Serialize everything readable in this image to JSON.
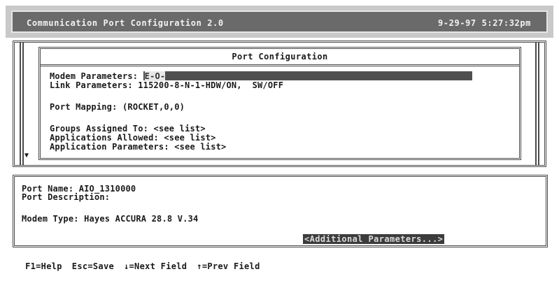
{
  "titlebar": {
    "title": "Communication Port Configuration  2.0",
    "datetime": "9-29-97 5:27:32pm"
  },
  "port_config": {
    "header": "Port Configuration",
    "modem_parameters_label": "Modem Parameters:",
    "modem_parameters_value": "E-O-",
    "link_parameters_label": "Link Parameters:",
    "link_parameters_value": "115200-8-N-1-HDW/ON,  SW/OFF",
    "port_mapping_label": "Port Mapping:",
    "port_mapping_value": "(ROCKET,0,0)",
    "groups_label": "Groups Assigned To:",
    "groups_value": "<see list>",
    "apps_allowed_label": "Applications Allowed:",
    "apps_allowed_value": "<see list>",
    "app_params_label": "Application Parameters:",
    "app_params_value": "<see list>",
    "scroll_indicator": "▼"
  },
  "port_info": {
    "port_name_label": "Port Name:",
    "port_name_value": "AIO_1310000",
    "port_description_label": "Port Description:",
    "port_description_value": "",
    "modem_type_label": "Modem Type:",
    "modem_type_value": "Hayes ACCURA 28.8 V.34",
    "additional_button": "<Additional Parameters...>"
  },
  "function_keys": [
    "F1=Help",
    "Esc=Save",
    "↓=Next Field",
    "↑=Prev Field"
  ]
}
